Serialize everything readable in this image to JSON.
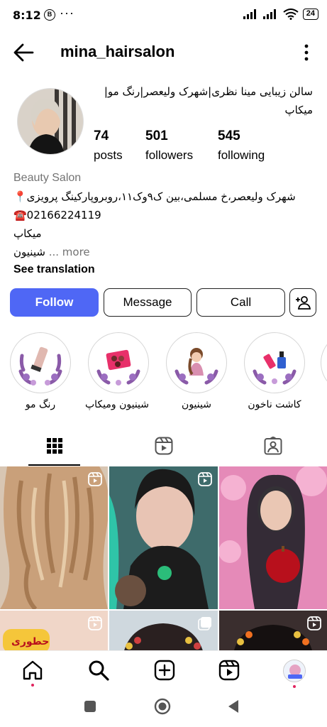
{
  "status_bar": {
    "time": "8:12",
    "left_icon": "B",
    "dots": "···",
    "battery": "24"
  },
  "header": {
    "username": "mina_hairsalon"
  },
  "profile": {
    "bio_top": "سالن زیبایی مینا نظری|شهرک ولیعصر|رنگ مو| میکاپ",
    "stats": [
      {
        "value": "74",
        "label": "posts"
      },
      {
        "value": "501",
        "label": "followers"
      },
      {
        "value": "545",
        "label": "following"
      }
    ],
    "category": "Beauty Salon",
    "address": "شهرک ولیعصر،خ مسلمی،بین ک۹وک۱۱،روبروپارکینگ پرویزی📍",
    "phone": "☎️02166224119",
    "line3": "میکاپ",
    "line4": "شینیون",
    "more": "... more",
    "see_translation": "See translation"
  },
  "buttons": {
    "follow": "Follow",
    "message": "Message",
    "call": "Call"
  },
  "highlights": [
    {
      "label": "رنگ مو"
    },
    {
      "label": "شینیون ومیکاپ"
    },
    {
      "label": "شینیون"
    },
    {
      "label": "کاشت ناخون"
    }
  ],
  "tiles": {
    "tile4_label": "حطوری"
  },
  "colors": {
    "accent": "#4f67f5",
    "text_secondary": "#737373",
    "notification": "#e0245e"
  }
}
